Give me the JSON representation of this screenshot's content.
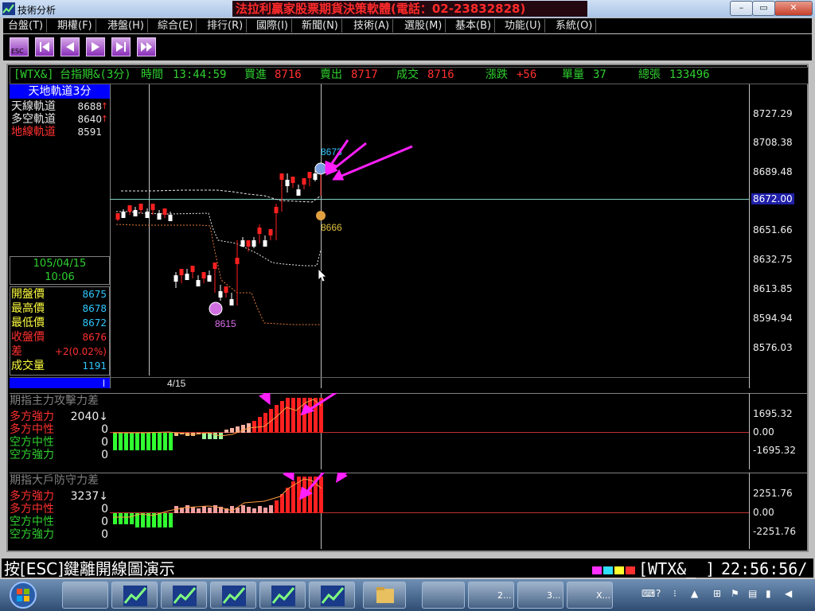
{
  "window": {
    "title": "技術分析",
    "banner": "法拉利贏家股票期貨決策軟體(電話：02-23832828)"
  },
  "menu": [
    "台盤(T)",
    "期權(F)",
    "港盤(H)",
    "綜合(E)",
    "排行(R)",
    "國際(I)",
    "新聞(N)",
    "技術(A)",
    "選股(M)",
    "基本(B)",
    "功能(U)",
    "系統(O)"
  ],
  "toolbar": {
    "esc_label": "ESC"
  },
  "quote": {
    "symbol": "[WTX&]",
    "name": "台指期&(3分)",
    "time_label": "時間",
    "time": "13:44:59",
    "bid_label": "買進",
    "bid": "8716",
    "ask_label": "賣出",
    "ask": "8717",
    "deal_label": "成交",
    "deal": "8716",
    "chg_label": "漲跌",
    "chg": "+56",
    "vol_label": "單量",
    "vol": "37",
    "total_label": "總張",
    "total": "133496"
  },
  "indicator": {
    "title": "天地軌道3分",
    "rows": [
      {
        "label": "天線軌道",
        "value": "8688",
        "arrow": "↑",
        "color": "#e8e8e8"
      },
      {
        "label": "多空軌道",
        "value": "8640",
        "arrow": "↑",
        "color": "#e8e8e8"
      },
      {
        "label": "地線軌道",
        "value": "8591",
        "arrow": "",
        "color": "#ff3030"
      }
    ]
  },
  "cursor": {
    "date": "105/04/15",
    "time": "10:06"
  },
  "ohlc": [
    {
      "label": "開盤價",
      "value": "8675",
      "color": "#ffff40",
      "vcolor": "#30c8ff"
    },
    {
      "label": "最高價",
      "value": "8678",
      "color": "#ffff40",
      "vcolor": "#30c8ff"
    },
    {
      "label": "最低價",
      "value": "8672",
      "color": "#ffff40",
      "vcolor": "#30c8ff"
    },
    {
      "label": "收盤價",
      "value": "8676",
      "color": "#ff3030",
      "vcolor": "#ff3030"
    },
    {
      "label": "差",
      "value": "+2(0.02%)",
      "color": "#ff3030",
      "vcolor": "#ff3030"
    },
    {
      "label": "成交量",
      "value": "1191",
      "color": "#ffff40",
      "vcolor": "#30c8ff"
    }
  ],
  "price_axis": {
    "ticks": [
      "8727.29",
      "8708.38",
      "8689.48",
      "8672.00",
      "8651.66",
      "8632.75",
      "8613.85",
      "8594.94",
      "8576.03"
    ],
    "highlight": "8672.00",
    "date_label": "4/15",
    "high_mark": "8673",
    "mid_mark": "8666",
    "low_mark": "8615"
  },
  "sub1": {
    "title": "期指主力攻擊力差",
    "rows": [
      {
        "label": "多方強力",
        "value": "2040↓",
        "color": "#ff3030"
      },
      {
        "label": "多方中性",
        "value": "0",
        "color": "#ff3030"
      },
      {
        "label": "空方中性",
        "value": "0",
        "color": "#2fd02f"
      },
      {
        "label": "空方強力",
        "value": "0",
        "color": "#2fd02f"
      }
    ],
    "ticks": [
      "1695.32",
      "0.00",
      "-1695.32"
    ]
  },
  "sub2": {
    "title": "期指大戶防守力差",
    "rows": [
      {
        "label": "多方強力",
        "value": "3237↓",
        "color": "#ff3030"
      },
      {
        "label": "多方中性",
        "value": "0",
        "color": "#ff3030"
      },
      {
        "label": "空方中性",
        "value": "0",
        "color": "#2fd02f"
      },
      {
        "label": "空方強力",
        "value": "0",
        "color": "#2fd02f"
      }
    ],
    "ticks": [
      "2251.76",
      "0.00",
      "-2251.76"
    ]
  },
  "status": {
    "hint": "按[ESC]鍵離開線圖演示",
    "symbol": "[WTX&_ ]",
    "clock": "22:56:56/"
  },
  "taskbar": {
    "items": [
      "2...",
      "3...",
      "X..."
    ]
  },
  "colors": {
    "up": "#ff2020",
    "down": "#ffffff",
    "arrow": "#ff00ff",
    "accent": "#0000ff"
  }
}
